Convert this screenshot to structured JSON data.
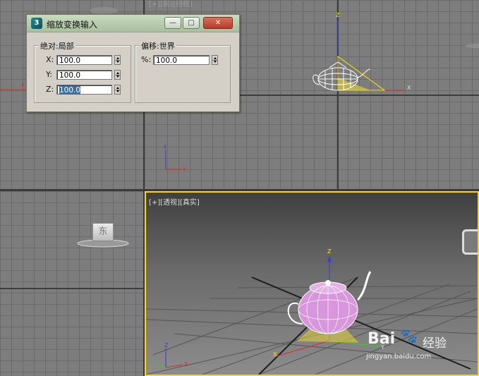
{
  "dialog": {
    "title": "缩放变换输入",
    "app_icon_glyph": "3",
    "minimize_glyph": "—",
    "maximize_glyph": "□",
    "close_glyph": "✕",
    "absolute_group": {
      "title": "绝对:局部",
      "rows": [
        {
          "label": "X:",
          "value": "100.0"
        },
        {
          "label": "Y:",
          "value": "100.0"
        },
        {
          "label": "Z:",
          "value": "100.0"
        }
      ]
    },
    "offset_group": {
      "title": "偏移:世界",
      "rows": [
        {
          "label": "%:",
          "value": "100.0"
        }
      ]
    }
  },
  "viewports": {
    "front": {
      "label": "[+][前][线框]"
    },
    "perspective": {
      "label": "[+][透视][真实]"
    },
    "left_view_cube": "东",
    "axis": {
      "x": "X",
      "y": "Y",
      "z": "Z"
    }
  },
  "watermark": {
    "brand": "Bai",
    "brand_suffix": "经验",
    "url": "jingyan.baidu.com"
  },
  "colors": {
    "active_border": "#ffd700",
    "axis_x": "#d62d2d",
    "axis_y": "#2fcf2f",
    "axis_z": "#3a3adf",
    "teapot_wire": "#ffffff",
    "teapot_shaded": "#d896dc",
    "gizmo": "#ffe600"
  }
}
